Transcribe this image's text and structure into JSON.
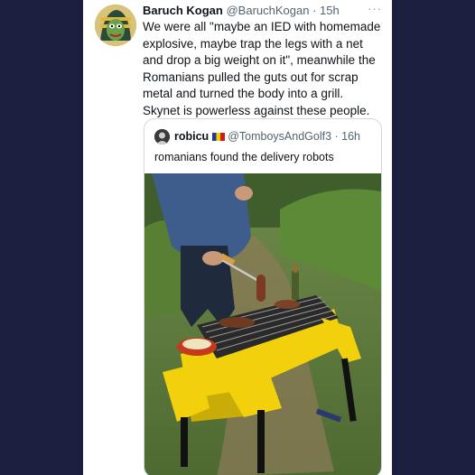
{
  "tweet": {
    "author_name": "Baruch Kogan",
    "author_handle": "@BaruchKogan",
    "time": "15h",
    "more_icon": "more-horizontal-icon",
    "text": "We were all \"maybe an IED with homemade explosive, maybe trap the legs with a net and drop a big weight on it\", meanwhile the Romanians pulled the guts out for scrap metal and turned the body into a grill. Skynet is powerless against these people."
  },
  "quoted": {
    "author_name": "robicu",
    "flag": "romania-flag-icon",
    "author_handle": "@TomboysAndGolf3",
    "time": "16h",
    "text": "romanians found the delivery robots"
  },
  "colors": {
    "background": "#1b1f3f",
    "card": "#ffffff",
    "robot": "#f2d10c"
  }
}
